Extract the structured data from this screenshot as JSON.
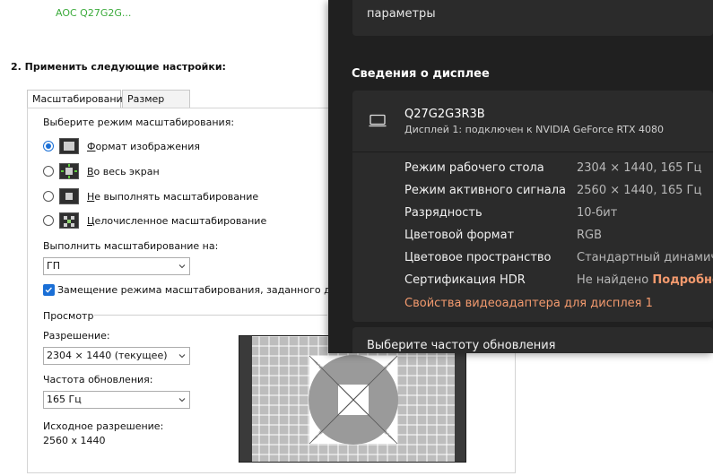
{
  "nvidia": {
    "monitor_link": "AOC Q27G2G...",
    "step_heading": "2. Применить следующие настройки:",
    "tabs": [
      {
        "label": "Масштабирование",
        "active": true
      },
      {
        "label": "Размер",
        "active": false
      }
    ],
    "scaling_mode_label": "Выберите режим масштабирования:",
    "scaling_modes": [
      {
        "pre": "",
        "underline": "Ф",
        "rest": "ормат изображения",
        "checked": true
      },
      {
        "pre": "",
        "underline": "В",
        "rest": "о весь экран",
        "checked": false
      },
      {
        "pre": "",
        "underline": "Н",
        "rest": "е выполнять масштабирование",
        "checked": false
      },
      {
        "pre": "",
        "underline": "Ц",
        "rest": "елочисленное масштабирование",
        "checked": false
      }
    ],
    "perform_on_label": "Выполнить масштабирование на:",
    "perform_on_value": "ГП",
    "override_label": "Замещение режима масштабирования, заданного для игр и",
    "override_checked": true,
    "preview_label": "Просмотр",
    "resolution_label": "Разрешение:",
    "resolution_value": "2304 × 1440 (текущее)",
    "refresh_label": "Частота обновления:",
    "refresh_value": "165 Гц",
    "native_label": "Исходное разрешение:",
    "native_value": "2560 x 1440"
  },
  "windows": {
    "top_card_text": "параметры",
    "section_title": "Сведения о дисплее",
    "monitor_name": "Q27G2G3R3B",
    "monitor_sub": "Дисплей 1: подключен к NVIDIA GeForce RTX 4080",
    "rows": [
      {
        "label": "Режим рабочего стола",
        "value": "2304 × 1440, 165 Гц"
      },
      {
        "label": "Режим активного сигнала",
        "value": "2560 × 1440, 165 Гц"
      },
      {
        "label": "Разрядность",
        "value": "10-бит"
      },
      {
        "label": "Цветовой формат",
        "value": "RGB"
      },
      {
        "label": "Цветовое пространство",
        "value": "Стандартный динамиче"
      },
      {
        "label": "Сертификация HDR",
        "value": "Не найдено",
        "link": "Подробнее"
      }
    ],
    "adapter_link": "Свойства видеоадаптера для дисплея 1",
    "bottom_card_text": "Выберите частоту обновления"
  },
  "colors": {
    "nvidia_green": "#3cab3c",
    "accent_blue": "#1a6fd6",
    "windows_bg": "#202020",
    "windows_card": "#2b2b2b",
    "windows_accent": "#f39a6e"
  }
}
